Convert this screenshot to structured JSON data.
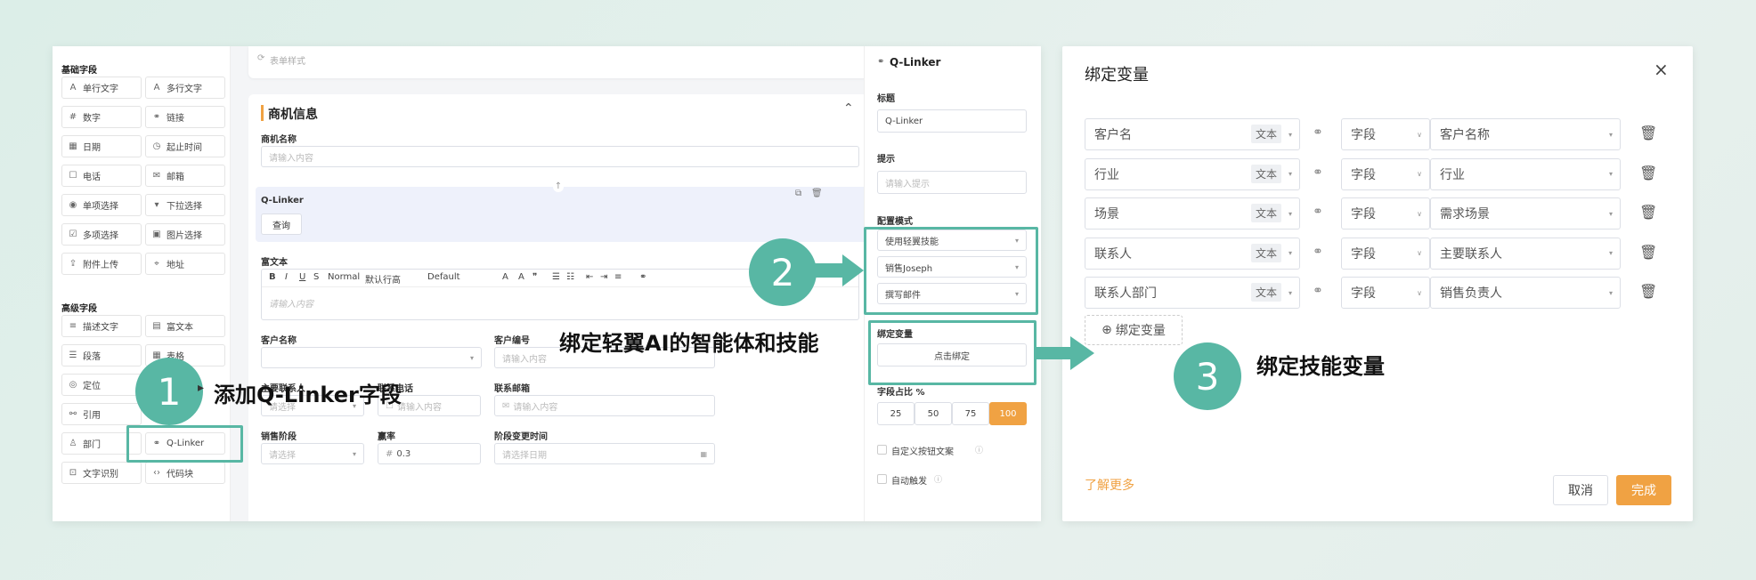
{
  "sidebar": {
    "basic_title": "基础字段",
    "basic_items": [
      {
        "icon": "A",
        "label": "单行文字"
      },
      {
        "icon": "A",
        "label": "多行文字"
      },
      {
        "icon": "#",
        "label": "数字"
      },
      {
        "icon": "⚭",
        "label": "链接"
      },
      {
        "icon": "▦",
        "label": "日期"
      },
      {
        "icon": "◷",
        "label": "起止时间"
      },
      {
        "icon": "☐",
        "label": "电话"
      },
      {
        "icon": "✉",
        "label": "邮箱"
      },
      {
        "icon": "◉",
        "label": "单项选择"
      },
      {
        "icon": "▾",
        "label": "下拉选择"
      },
      {
        "icon": "☑",
        "label": "多项选择"
      },
      {
        "icon": "▣",
        "label": "图片选择"
      },
      {
        "icon": "⇪",
        "label": "附件上传"
      },
      {
        "icon": "⌖",
        "label": "地址"
      }
    ],
    "advanced_title": "高级字段",
    "advanced_items": [
      {
        "icon": "≡",
        "label": "描述文字"
      },
      {
        "icon": "▤",
        "label": "富文本"
      },
      {
        "icon": "☰",
        "label": "段落"
      },
      {
        "icon": "▦",
        "label": "表格"
      },
      {
        "icon": "◎",
        "label": "定位"
      },
      {
        "icon": "⚯",
        "label": "引用"
      },
      {
        "icon": "♙",
        "label": "部门"
      },
      {
        "icon": "⚭",
        "label": "Q-Linker"
      },
      {
        "icon": "⊡",
        "label": "文字识别"
      },
      {
        "icon": "‹›",
        "label": "代码块"
      }
    ]
  },
  "form": {
    "top_hint": "表单样式",
    "section_title": "商机信息",
    "name_label": "商机名称",
    "name_placeholder": "请输入内容",
    "qlinker_label": "Q-Linker",
    "query_button": "查询",
    "rich_label": "富文本",
    "rich_toolbar": {
      "normal": "Normal",
      "line_height": "默认行高",
      "font": "Default"
    },
    "rich_placeholder": "请输入内容",
    "customer_label": "客户名称",
    "customer_no_label": "客户编号",
    "customer_no_placeholder": "请输入内容",
    "contact_label": "主要联系人",
    "contact_placeholder": "请选择",
    "phone_label": "联系电话",
    "phone_placeholder": "请输入内容",
    "email_label": "联系邮箱",
    "email_placeholder": "请输入内容",
    "stage_label": "销售阶段",
    "stage_placeholder": "请选择",
    "win_label": "赢率",
    "win_value": "0.3",
    "stage_time_label": "阶段变更时间",
    "stage_time_placeholder": "请选择日期"
  },
  "props": {
    "title": "Q-Linker",
    "title_label": "标题",
    "title_value": "Q-Linker",
    "hint_label": "提示",
    "hint_placeholder": "请输入提示",
    "mode_label": "配置模式",
    "mode_options": [
      "使用轻翼技能",
      "销售Joseph",
      "撰写邮件"
    ],
    "bind_label": "绑定变量",
    "bind_button": "点击绑定",
    "ratio_label": "字段占比 %",
    "ratio_options": [
      "25",
      "50",
      "75",
      "100"
    ],
    "ratio_selected": "100",
    "custom_btn_label": "自定义按钮文案",
    "auto_trigger_label": "自动触发"
  },
  "modal": {
    "title": "绑定变量",
    "rows": [
      {
        "var": "客户名",
        "type": "文本",
        "source": "字段",
        "field": "客户名称"
      },
      {
        "var": "行业",
        "type": "文本",
        "source": "字段",
        "field": "行业"
      },
      {
        "var": "场景",
        "type": "文本",
        "source": "字段",
        "field": "需求场景"
      },
      {
        "var": "联系人",
        "type": "文本",
        "source": "字段",
        "field": "主要联系人"
      },
      {
        "var": "联系人部门",
        "type": "文本",
        "source": "字段",
        "field": "销售负责人"
      }
    ],
    "add_button": "绑定变量",
    "learn_more": "了解更多",
    "cancel": "取消",
    "confirm": "完成"
  },
  "annotations": {
    "step1_num": "1",
    "step1_text": "添加Q-Linker字段",
    "step2_num": "2",
    "step2_text": "绑定轻翼AI的智能体和技能",
    "step3_num": "3",
    "step3_text": "绑定技能变量"
  },
  "colors": {
    "teal": "#58b7a4",
    "orange": "#f0a243",
    "accent_bar": "#f0a243"
  }
}
